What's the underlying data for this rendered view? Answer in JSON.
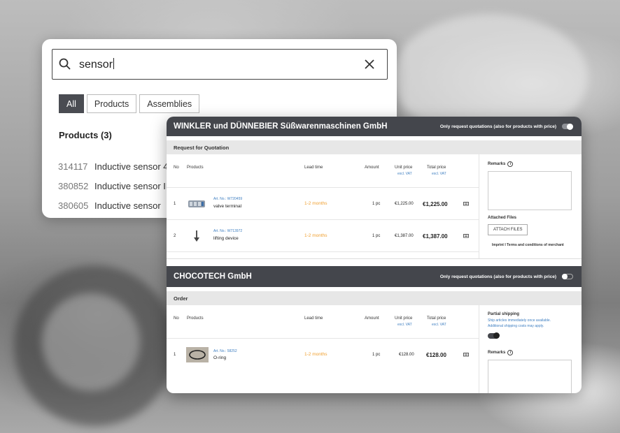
{
  "search": {
    "query": "sensor",
    "filters": [
      {
        "label": "All",
        "active": true
      },
      {
        "label": "Products",
        "active": false
      },
      {
        "label": "Assemblies",
        "active": false
      }
    ],
    "section_title": "Products (3)",
    "results": [
      {
        "number": "314117",
        "name": "Inductive sensor 4r"
      },
      {
        "number": "380852",
        "name": "Inductive sensor IM"
      },
      {
        "number": "380605",
        "name": "Inductive sensor"
      }
    ]
  },
  "merchants": [
    {
      "name": "WINKLER und DÜNNEBIER Süßwarenmaschinen GmbH",
      "toggle_label": "Only request quotations (also for products with price)",
      "toggle_on": true,
      "section": "Request for Quotation",
      "headers": {
        "no": "No",
        "products": "Products",
        "lead": "Lead time",
        "amount": "Amount",
        "unit": "Unit price",
        "unit_sub": "excl. VAT",
        "total": "Total price",
        "total_sub": "excl. VAT"
      },
      "rows": [
        {
          "no": "1",
          "art": "Art. No.: W720459",
          "name": "valve terminal",
          "lead": "1-2 months",
          "amount": "1 pc",
          "unit": "€1,225.00",
          "total": "€1,225.00",
          "icon": "valve-terminal-thumb"
        },
        {
          "no": "2",
          "art": "Art. No.: W713972",
          "name": "lifting device",
          "lead": "1-2 months",
          "amount": "1 pc",
          "unit": "€1,387.00",
          "total": "€1,387.00",
          "icon": "lifting-device-thumb"
        }
      ],
      "remarks_label": "Remarks",
      "attached_label": "Attached Files",
      "attach_button": "ATTACH FILES",
      "footer_links": "Imprint I Terms and conditions of merchant"
    },
    {
      "name": "CHOCOTECH GmbH",
      "toggle_label": "Only request quotations (also for products with price)",
      "toggle_on": false,
      "section": "Order",
      "headers": {
        "no": "No",
        "products": "Products",
        "lead": "Lead time",
        "amount": "Amount",
        "unit": "Unit price",
        "unit_sub": "excl. VAT",
        "total": "Total price",
        "total_sub": "excl. VAT"
      },
      "rows": [
        {
          "no": "1",
          "art": "Art. No.: 58252",
          "name": "O-ring",
          "lead": "1-2 months",
          "amount": "1 pc",
          "unit": "€128.00",
          "total": "€128.00",
          "icon": "o-ring-thumb"
        }
      ],
      "partial_label": "Partial shipping",
      "partial_note_1": "Ship articles immediately once available.",
      "partial_note_2": "Additional shipping costs may apply.",
      "remarks_label": "Remarks"
    }
  ],
  "colors": {
    "dark_bar": "#44464c",
    "accent_blue": "#3f7fc1",
    "lead_orange": "#f0a030"
  }
}
